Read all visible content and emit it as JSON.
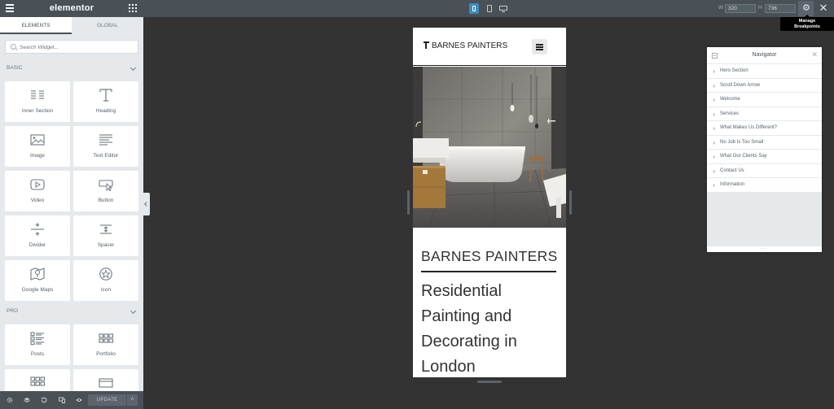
{
  "panel": {
    "logo": "elementor",
    "tabs": [
      {
        "label": "ELEMENTS",
        "active": true
      },
      {
        "label": "GLOBAL",
        "active": false
      }
    ],
    "search_placeholder": "Search Widget...",
    "categories": {
      "basic": "BASIC",
      "pro": "PRO"
    },
    "widgets": {
      "inner_section": "Inner Section",
      "heading": "Heading",
      "image": "Image",
      "text_editor": "Text Editor",
      "video": "Video",
      "button": "Button",
      "divider": "Divider",
      "spacer": "Spacer",
      "google_maps": "Google Maps",
      "icon": "Icon",
      "posts": "Posts",
      "portfolio": "Portfolio"
    },
    "footer": {
      "update_label": "UPDATE",
      "more_label": "˄"
    }
  },
  "topbar": {
    "width_label": "W",
    "width_value": "320",
    "height_label": "H",
    "height_value": "736",
    "tooltip_line1": "Manage",
    "tooltip_line2": "Breakpoints",
    "close_glyph": "✕",
    "gear_glyph": "⚙",
    "active_device": "mobile"
  },
  "preview": {
    "site_logo": "BARNES PAINTERS",
    "brand_heading": "BARNES PAINTERS",
    "title": "Residential Painting and Decorating in London"
  },
  "navigator": {
    "title": "Navigator",
    "close_glyph": "✕",
    "footer_dots": "...",
    "items": [
      "Hero Section",
      "Scroll Down Arrow",
      "Welcome",
      "Services",
      "What Makes Us Different?",
      "No Job Is Too Small",
      "What Our Clients Say",
      "Contact Us",
      "Information"
    ]
  },
  "colors": {
    "panel_header": "#495157",
    "canvas": "#333333",
    "accent": "#3b8dbd"
  }
}
